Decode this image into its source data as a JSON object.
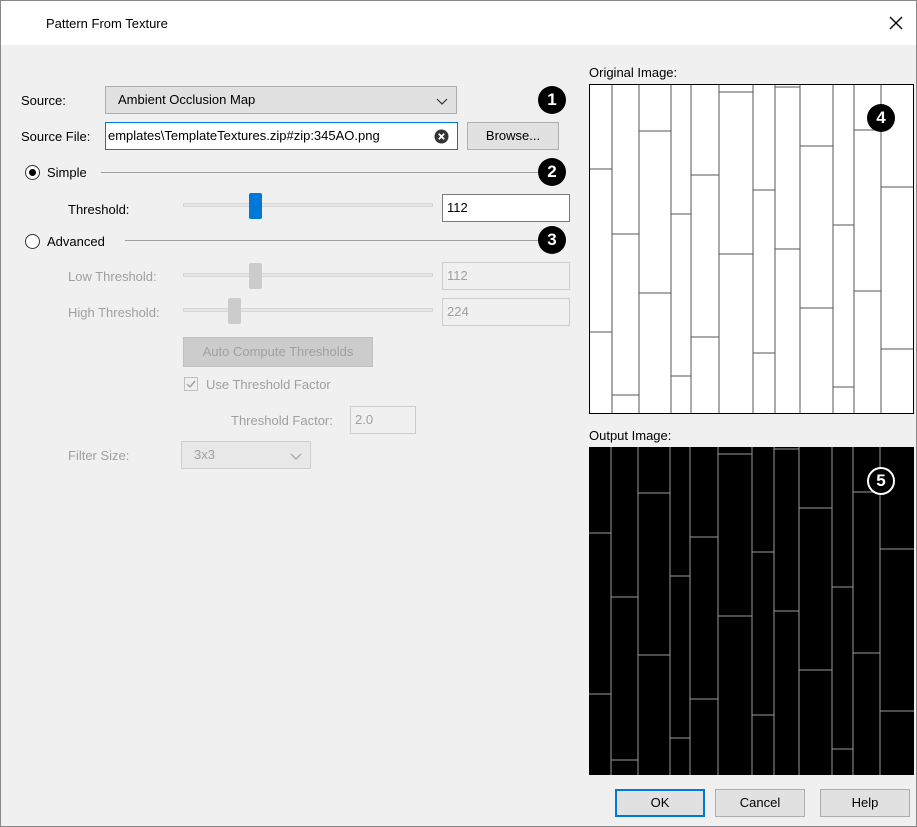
{
  "window": {
    "title": "Pattern From Texture"
  },
  "source": {
    "label": "Source:",
    "value": "Ambient Occlusion Map"
  },
  "source_file": {
    "label": "Source File:",
    "value": "emplates\\TemplateTextures.zip#zip:345AO.png",
    "browse_label": "Browse..."
  },
  "simple": {
    "label": "Simple",
    "selected": true,
    "threshold_label": "Threshold:",
    "threshold_value": "112"
  },
  "advanced": {
    "label": "Advanced",
    "selected": false,
    "low_label": "Low Threshold:",
    "low_value": "112",
    "high_label": "High Threshold:",
    "high_value": "224",
    "auto_compute_label": "Auto Compute Thresholds",
    "use_factor_label": "Use Threshold Factor",
    "use_factor_checked": true,
    "factor_label": "Threshold Factor:",
    "factor_value": "2.0",
    "filter_label": "Filter Size:",
    "filter_value": "3x3"
  },
  "preview": {
    "original_label": "Original Image:",
    "output_label": "Output Image:"
  },
  "callouts": [
    "1",
    "2",
    "3",
    "4",
    "5"
  ],
  "buttons": {
    "ok": "OK",
    "cancel": "Cancel",
    "help": "Help"
  },
  "colors": {
    "accent": "#0078d7",
    "dialog_bg": "#f0f0f0",
    "output_bg": "#000000"
  }
}
